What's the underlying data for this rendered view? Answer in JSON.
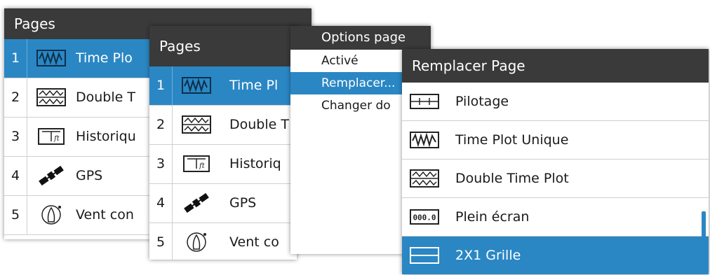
{
  "colors": {
    "accent": "#2a87c4",
    "header": "#3a3a3a"
  },
  "pages_back": {
    "title": "Pages",
    "items": [
      {
        "num": "1",
        "label": "Time Plo",
        "icon": "single-wave-icon"
      },
      {
        "num": "2",
        "label": "Double T",
        "icon": "double-wave-icon"
      },
      {
        "num": "3",
        "label": "Historiqu",
        "icon": "history-lft-icon"
      },
      {
        "num": "4",
        "label": "GPS",
        "icon": "satellite-icon"
      },
      {
        "num": "5",
        "label": "Vent con",
        "icon": "boat-wind-icon"
      }
    ]
  },
  "pages_front": {
    "title": "Pages",
    "items": [
      {
        "num": "1",
        "label": "Time Pl",
        "icon": "single-wave-icon"
      },
      {
        "num": "2",
        "label": "Double T",
        "icon": "double-wave-icon"
      },
      {
        "num": "3",
        "label": "Historiq",
        "icon": "history-lft-icon"
      },
      {
        "num": "4",
        "label": "GPS",
        "icon": "satellite-icon"
      },
      {
        "num": "5",
        "label": "Vent co",
        "icon": "boat-wind-icon"
      }
    ]
  },
  "options": {
    "title": "Options page",
    "items": [
      "Activé",
      "Remplacer...",
      "Changer do"
    ]
  },
  "replace": {
    "title": "Remplacer Page",
    "items": [
      {
        "label": "Pilotage",
        "icon": "layout-icon"
      },
      {
        "label": "Time Plot Unique",
        "icon": "single-wave-icon"
      },
      {
        "label": "Double Time Plot",
        "icon": "double-wave-icon"
      },
      {
        "label": "Plein écran",
        "icon": "digital-readout-icon"
      },
      {
        "label": "2X1 Grille",
        "icon": "grid-2x1-icon"
      }
    ]
  }
}
